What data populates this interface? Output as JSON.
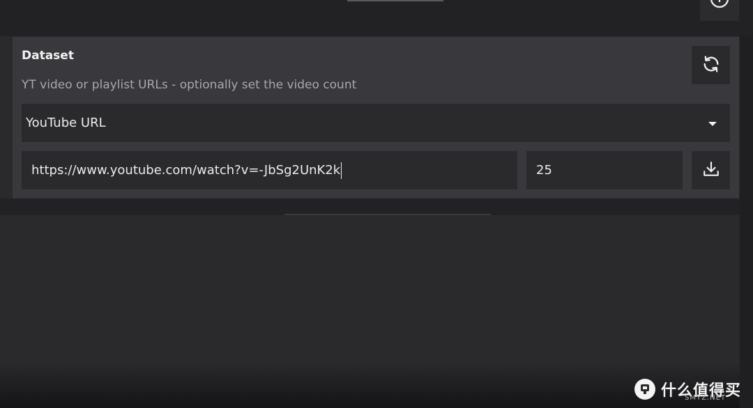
{
  "panel": {
    "title": "Dataset",
    "description": "YT video or playlist URLs - optionally set the video count"
  },
  "source_select": {
    "value": "YouTube URL",
    "options": [
      "YouTube URL"
    ]
  },
  "url_input": {
    "value": "https://www.youtube.com/watch?v=-JbSg2UnK2k"
  },
  "count_input": {
    "value": "25"
  },
  "icons": {
    "top_right": "clock-icon",
    "refresh": "refresh-icon",
    "dropdown": "chevron-down-icon",
    "download": "download-icon"
  },
  "watermark": {
    "text": "什么值得买",
    "sub": "SMYZ.NET"
  },
  "colors": {
    "background": "#2a292c",
    "panel": "#39383c",
    "field": "#2a292c",
    "text": "#ececec",
    "muted_text": "#a9a8ad"
  }
}
